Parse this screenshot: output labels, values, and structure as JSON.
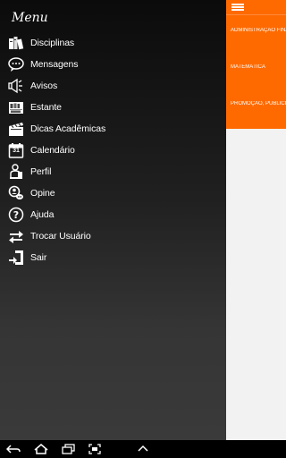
{
  "drawer": {
    "title": "Menu",
    "items": [
      {
        "label": "Disciplinas",
        "icon": "books-icon"
      },
      {
        "label": "Mensagens",
        "icon": "chat-bubble-icon"
      },
      {
        "label": "Avisos",
        "icon": "megaphone-icon"
      },
      {
        "label": "Estante",
        "icon": "bookshelf-icon"
      },
      {
        "label": "Dicas Acadêmicas",
        "icon": "clapperboard-icon"
      },
      {
        "label": "Calendário",
        "icon": "calendar-icon"
      },
      {
        "label": "Perfil",
        "icon": "person-icon"
      },
      {
        "label": "Opine",
        "icon": "opinion-icon"
      },
      {
        "label": "Ajuda",
        "icon": "help-icon"
      },
      {
        "label": "Trocar Usuário",
        "icon": "swap-arrows-icon"
      },
      {
        "label": "Sair",
        "icon": "exit-icon"
      }
    ],
    "calendar_day": "31"
  },
  "content": {
    "courses": [
      "ADMINISTRAÇÃO FINANCEIRA",
      "MATEMÁTICA",
      "PROMOÇÃO, PUBLICIDADE"
    ]
  },
  "colors": {
    "accent": "#ff6a00",
    "drawer_top": "#0b0b0b",
    "drawer_bottom": "#3a3a3a",
    "content_bg": "#f2f2f2"
  },
  "system_nav": [
    "back-icon",
    "home-icon",
    "recents-icon",
    "screenshot-icon",
    "up-chevron-icon"
  ]
}
